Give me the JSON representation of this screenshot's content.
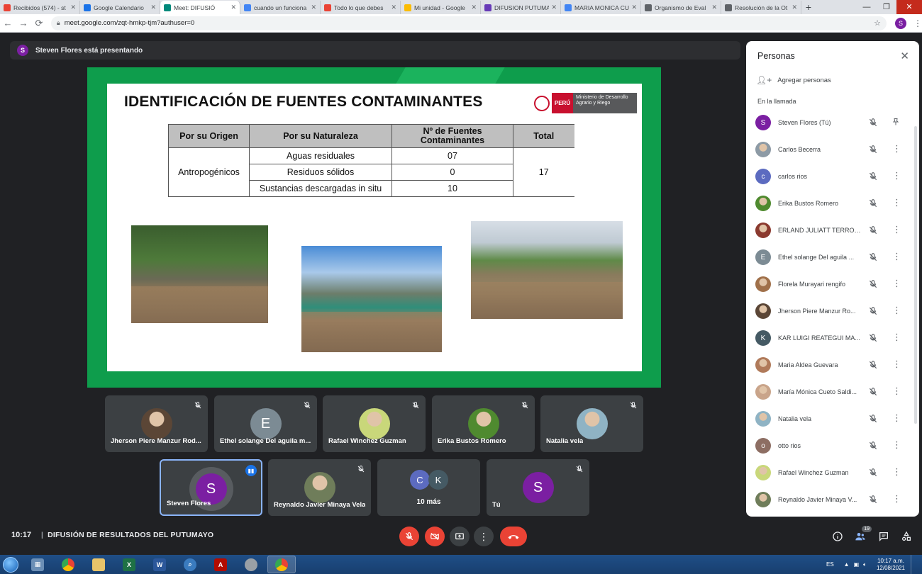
{
  "browser": {
    "tabs": [
      {
        "label": "Recibidos (574) - st",
        "color": "#ea4335",
        "active": false
      },
      {
        "label": "Google Calendario",
        "color": "#1a73e8",
        "active": false
      },
      {
        "label": "Meet: DIFUSIÓ",
        "color": "#00897b",
        "active": true
      },
      {
        "label": "cuando un funciona",
        "color": "#4285f4",
        "active": false
      },
      {
        "label": "Todo lo que debes",
        "color": "#ea4335",
        "active": false
      },
      {
        "label": "Mi unidad - Google",
        "color": "#fbbc04",
        "active": false
      },
      {
        "label": "DIFUSION PUTUMA",
        "color": "#673ab7",
        "active": false
      },
      {
        "label": "MARIA MONICA CU",
        "color": "#4285f4",
        "active": false
      },
      {
        "label": "Organismo de Eval",
        "color": "#5f6368",
        "active": false
      },
      {
        "label": "Resolución de la Ot",
        "color": "#5f6368",
        "active": false
      }
    ],
    "url": "meet.google.com/zqt-hmkp-tjm?authuser=0",
    "profile_initial": "S"
  },
  "presenting": {
    "avatar_initial": "S",
    "text": "Steven Flores está presentando"
  },
  "slide": {
    "title": "IDENTIFICACIÓN DE FUENTES CONTAMINANTES",
    "logo": {
      "country": "PERÚ",
      "ministry": "Ministerio de Desarrollo Agrario y Riego"
    },
    "table": {
      "headers": [
        "Por su Origen",
        "Por su Naturaleza",
        "Nº de Fuentes Contaminantes",
        "Total"
      ],
      "origin": "Antropogénicos",
      "rows": [
        {
          "nature": "Aguas residuales",
          "count": "07"
        },
        {
          "nature": "Residuos sólidos",
          "count": "0"
        },
        {
          "nature": "Sustancias descargadas in situ",
          "count": "10"
        }
      ],
      "total": "17"
    }
  },
  "tiles": [
    {
      "name": "Jherson Piere Manzur Rod...",
      "avatar": "photo",
      "color": "#5b4636"
    },
    {
      "name": "Ethel solange Del aguila m...",
      "avatar": "E",
      "color": "#7c8b94"
    },
    {
      "name": "Rafael Winchez Guzman",
      "avatar": "photo",
      "color": "#c9d77a"
    },
    {
      "name": "Erika Bustos Romero",
      "avatar": "photo",
      "color": "#4f8a2f"
    },
    {
      "name": "Natalia vela",
      "avatar": "photo",
      "color": "#8fb3c4"
    },
    {
      "name": "Steven Flores",
      "avatar": "S",
      "color": "#7b1fa2"
    },
    {
      "name": "Reynaldo Javier Minaya Vela",
      "avatar": "photo",
      "color": "#6f7d5a"
    },
    {
      "name": "Tú",
      "avatar": "S",
      "color": "#7b1fa2"
    }
  ],
  "more_tile": {
    "label": "10 más",
    "initials": [
      "C",
      "K"
    ],
    "colors": [
      "#5c6bc0",
      "#455a64"
    ]
  },
  "bottom": {
    "time": "10:17",
    "separator": "|",
    "meeting": "DIFUSIÓN DE RESULTADOS DEL PUTUMAYO",
    "participants_count": "19"
  },
  "people_panel": {
    "title": "Personas",
    "add_people": "Agregar personas",
    "section": "En la llamada",
    "people": [
      {
        "name": "Steven Flores (Tú)",
        "initial": "S",
        "color": "#7b1fa2",
        "pinned": true
      },
      {
        "name": "Carlos Becerra",
        "initial": "",
        "color": "#8d9aa5",
        "pinned": false
      },
      {
        "name": "carlos rios",
        "initial": "c",
        "color": "#5c6bc0",
        "pinned": false
      },
      {
        "name": "Erika Bustos Romero",
        "initial": "",
        "color": "#4f8a2f",
        "pinned": false
      },
      {
        "name": "ERLAND JULIATT TERRON...",
        "initial": "",
        "color": "#8b3a2f",
        "pinned": false
      },
      {
        "name": "Ethel solange Del aguila ...",
        "initial": "E",
        "color": "#7c8b94",
        "pinned": false
      },
      {
        "name": "Florela Murayari rengifo",
        "initial": "",
        "color": "#a0704a",
        "pinned": false
      },
      {
        "name": "Jherson Piere Manzur Ro...",
        "initial": "",
        "color": "#5b4636",
        "pinned": false
      },
      {
        "name": "KAR LUIGI REATEGUI MA...",
        "initial": "K",
        "color": "#455a64",
        "pinned": false
      },
      {
        "name": "Maria Aldea Guevara",
        "initial": "",
        "color": "#b07a5a",
        "pinned": false
      },
      {
        "name": "María Mónica Cueto Saldi...",
        "initial": "",
        "color": "#c9a48a",
        "pinned": false
      },
      {
        "name": "Natalia vela",
        "initial": "",
        "color": "#8fb3c4",
        "pinned": false
      },
      {
        "name": "otto rios",
        "initial": "o",
        "color": "#8d6e63",
        "pinned": false
      },
      {
        "name": "Rafael Winchez Guzman",
        "initial": "",
        "color": "#c9d77a",
        "pinned": false
      },
      {
        "name": "Reynaldo Javier Minaya V...",
        "initial": "",
        "color": "#6f7d5a",
        "pinned": false
      }
    ]
  },
  "taskbar": {
    "lang": "ES",
    "time": "10:17 a.m.",
    "date": "12/08/2021",
    "apps": [
      "windows-orb",
      "calculator",
      "chrome",
      "explorer",
      "excel",
      "word",
      "magnifier",
      "acrobat",
      "media",
      "chrome-active"
    ]
  }
}
